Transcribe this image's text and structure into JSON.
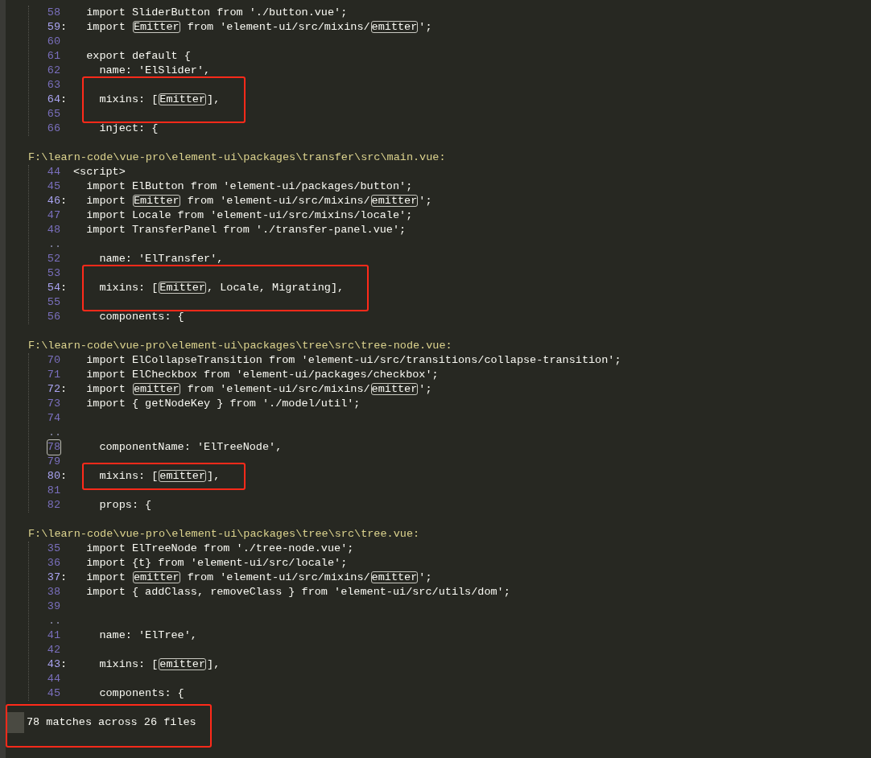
{
  "sections": [
    {
      "lines": [
        {
          "kind": "line",
          "num": "58",
          "match": false,
          "code": [
            {
              "text": "  import SliderButton from './button.vue';",
              "match": false
            }
          ]
        },
        {
          "kind": "line",
          "num": "59",
          "sep": ":",
          "match": true,
          "code": [
            {
              "text": "  import ",
              "match": false
            },
            {
              "text": "Emitter",
              "match": true
            },
            {
              "text": " from 'element-ui/src/mixins/",
              "match": false
            },
            {
              "text": "emitter",
              "match": true
            },
            {
              "text": "';",
              "match": false
            }
          ]
        },
        {
          "kind": "line",
          "num": "60",
          "match": false
        },
        {
          "kind": "line",
          "num": "61",
          "match": false,
          "code": [
            {
              "text": "  export default {",
              "match": false
            }
          ]
        },
        {
          "kind": "line",
          "num": "62",
          "match": false,
          "code": [
            {
              "text": "    name: 'ElSlider',",
              "match": false
            }
          ]
        },
        {
          "kind": "line",
          "num": "63",
          "match": false,
          "annotated": true
        },
        {
          "kind": "line",
          "num": "64",
          "sep": ":",
          "match": true,
          "annotated": true,
          "code": [
            {
              "text": "    mixins: [",
              "match": false
            },
            {
              "text": "Emitter",
              "match": true
            },
            {
              "text": "],",
              "match": false
            }
          ]
        },
        {
          "kind": "line",
          "num": "65",
          "match": false,
          "annotated": true
        },
        {
          "kind": "line",
          "num": "66",
          "match": false,
          "code": [
            {
              "text": "    inject: {",
              "match": false
            }
          ]
        }
      ]
    },
    {
      "path": "F:\\learn-code\\vue-pro\\element-ui\\packages\\transfer\\src\\main.vue:",
      "lines": [
        {
          "kind": "line",
          "num": "44",
          "match": false,
          "code": [
            {
              "text": "<script>",
              "match": false
            }
          ]
        },
        {
          "kind": "line",
          "num": "45",
          "match": false,
          "code": [
            {
              "text": "  import ElButton from 'element-ui/packages/button';",
              "match": false
            }
          ]
        },
        {
          "kind": "line",
          "num": "46",
          "sep": ":",
          "match": true,
          "code": [
            {
              "text": "  import ",
              "match": false
            },
            {
              "text": "Emitter",
              "match": true
            },
            {
              "text": " from 'element-ui/src/mixins/",
              "match": false
            },
            {
              "text": "emitter",
              "match": true
            },
            {
              "text": "';",
              "match": false
            }
          ]
        },
        {
          "kind": "line",
          "num": "47",
          "match": false,
          "code": [
            {
              "text": "  import Locale from 'element-ui/src/mixins/locale';",
              "match": false
            }
          ]
        },
        {
          "kind": "line",
          "num": "48",
          "match": false,
          "code": [
            {
              "text": "  import TransferPanel from './transfer-panel.vue';",
              "match": false
            }
          ]
        },
        {
          "kind": "gap",
          "text": ".."
        },
        {
          "kind": "line",
          "num": "52",
          "match": false,
          "code": [
            {
              "text": "    name: 'ElTransfer',",
              "match": false
            }
          ]
        },
        {
          "kind": "line",
          "num": "53",
          "match": false,
          "annotated": true
        },
        {
          "kind": "line",
          "num": "54",
          "sep": ":",
          "match": true,
          "annotated": true,
          "code": [
            {
              "text": "    mixins: [",
              "match": false
            },
            {
              "text": "Emitter",
              "match": true
            },
            {
              "text": ", Locale, Migrating],",
              "match": false
            }
          ]
        },
        {
          "kind": "line",
          "num": "55",
          "match": false,
          "annotated": true
        },
        {
          "kind": "line",
          "num": "56",
          "match": false,
          "code": [
            {
              "text": "    components: {",
              "match": false
            }
          ]
        }
      ]
    },
    {
      "path": "F:\\learn-code\\vue-pro\\element-ui\\packages\\tree\\src\\tree-node.vue:",
      "lines": [
        {
          "kind": "line",
          "num": "70",
          "match": false,
          "code": [
            {
              "text": "  import ElCollapseTransition from 'element-ui/src/transitions/collapse-transition';",
              "match": false
            }
          ]
        },
        {
          "kind": "line",
          "num": "71",
          "match": false,
          "code": [
            {
              "text": "  import ElCheckbox from 'element-ui/packages/checkbox';",
              "match": false
            }
          ]
        },
        {
          "kind": "line",
          "num": "72",
          "sep": ":",
          "match": true,
          "code": [
            {
              "text": "  import ",
              "match": false
            },
            {
              "text": "emitter",
              "match": true
            },
            {
              "text": " from 'element-ui/src/mixins/",
              "match": false
            },
            {
              "text": "emitter",
              "match": true
            },
            {
              "text": "';",
              "match": false
            }
          ]
        },
        {
          "kind": "line",
          "num": "73",
          "match": false,
          "code": [
            {
              "text": "  import { getNodeKey } from './model/util';",
              "match": false
            }
          ]
        },
        {
          "kind": "line",
          "num": "74",
          "match": false
        },
        {
          "kind": "gap",
          "text": ".."
        },
        {
          "kind": "line",
          "num": "78",
          "match": false,
          "cursor": true,
          "code": [
            {
              "text": "    componentName: 'ElTreeNode',",
              "match": false
            }
          ]
        },
        {
          "kind": "line",
          "num": "79",
          "match": false
        },
        {
          "kind": "line",
          "num": "80",
          "sep": ":",
          "match": true,
          "annotated": true,
          "code": [
            {
              "text": "    mixins: [",
              "match": false
            },
            {
              "text": "emitter",
              "match": true
            },
            {
              "text": "],",
              "match": false
            }
          ]
        },
        {
          "kind": "line",
          "num": "81",
          "match": false
        },
        {
          "kind": "line",
          "num": "82",
          "match": false,
          "code": [
            {
              "text": "    props: {",
              "match": false
            }
          ]
        }
      ]
    },
    {
      "path": "F:\\learn-code\\vue-pro\\element-ui\\packages\\tree\\src\\tree.vue:",
      "lines": [
        {
          "kind": "line",
          "num": "35",
          "match": false,
          "code": [
            {
              "text": "  import ElTreeNode from './tree-node.vue';",
              "match": false
            }
          ]
        },
        {
          "kind": "line",
          "num": "36",
          "match": false,
          "code": [
            {
              "text": "  import {t} from 'element-ui/src/locale';",
              "match": false
            }
          ]
        },
        {
          "kind": "line",
          "num": "37",
          "sep": ":",
          "match": true,
          "code": [
            {
              "text": "  import ",
              "match": false
            },
            {
              "text": "emitter",
              "match": true
            },
            {
              "text": " from 'element-ui/src/mixins/",
              "match": false
            },
            {
              "text": "emitter",
              "match": true
            },
            {
              "text": "';",
              "match": false
            }
          ]
        },
        {
          "kind": "line",
          "num": "38",
          "match": false,
          "code": [
            {
              "text": "  import { addClass, removeClass } from 'element-ui/src/utils/dom';",
              "match": false
            }
          ]
        },
        {
          "kind": "line",
          "num": "39",
          "match": false
        },
        {
          "kind": "gap",
          "text": ".."
        },
        {
          "kind": "line",
          "num": "41",
          "match": false,
          "code": [
            {
              "text": "    name: 'ElTree',",
              "match": false
            }
          ]
        },
        {
          "kind": "line",
          "num": "42",
          "match": false
        },
        {
          "kind": "line",
          "num": "43",
          "sep": ":",
          "match": true,
          "code": [
            {
              "text": "    mixins: [",
              "match": false
            },
            {
              "text": "emitter",
              "match": true
            },
            {
              "text": "],",
              "match": false
            }
          ]
        },
        {
          "kind": "line",
          "num": "44",
          "match": false
        },
        {
          "kind": "line",
          "num": "45",
          "match": false,
          "code": [
            {
              "text": "    components: {",
              "match": false
            }
          ]
        }
      ]
    }
  ],
  "status": {
    "text": "78 matches across 26 files",
    "annotated": true
  }
}
